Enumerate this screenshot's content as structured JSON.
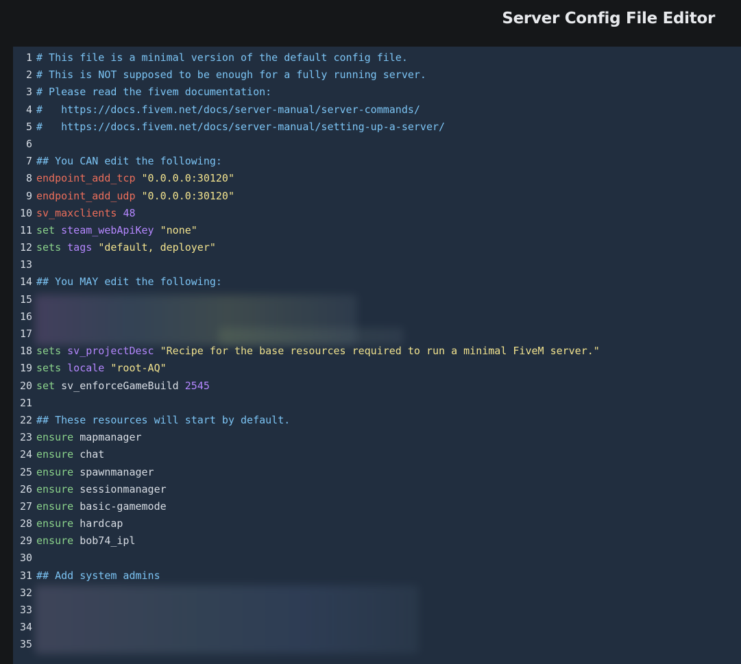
{
  "header": {
    "title": "Server Config File Editor"
  },
  "editor": {
    "lines": [
      {
        "n": "1",
        "segments": [
          {
            "t": "# This file is a minimal version of the default config file.",
            "c": "comment"
          }
        ]
      },
      {
        "n": "2",
        "segments": [
          {
            "t": "# This is NOT supposed to be enough for a fully running server.",
            "c": "comment"
          }
        ]
      },
      {
        "n": "3",
        "segments": [
          {
            "t": "# Please read the fivem documentation:",
            "c": "comment"
          }
        ]
      },
      {
        "n": "4",
        "segments": [
          {
            "t": "#   https://docs.fivem.net/docs/server-manual/server-commands/",
            "c": "comment"
          }
        ]
      },
      {
        "n": "5",
        "segments": [
          {
            "t": "#   https://docs.fivem.net/docs/server-manual/setting-up-a-server/",
            "c": "comment"
          }
        ]
      },
      {
        "n": "6",
        "segments": []
      },
      {
        "n": "7",
        "segments": [
          {
            "t": "## You CAN edit the following:",
            "c": "comment"
          }
        ]
      },
      {
        "n": "8",
        "segments": [
          {
            "t": "endpoint_add_tcp",
            "c": "redkey"
          },
          {
            "t": " ",
            "c": "plain"
          },
          {
            "t": "\"0.0.0.0:30120\"",
            "c": "str"
          }
        ]
      },
      {
        "n": "9",
        "segments": [
          {
            "t": "endpoint_add_udp",
            "c": "redkey"
          },
          {
            "t": " ",
            "c": "plain"
          },
          {
            "t": "\"0.0.0.0:30120\"",
            "c": "str"
          }
        ]
      },
      {
        "n": "10",
        "segments": [
          {
            "t": "sv_maxclients",
            "c": "redkey"
          },
          {
            "t": " ",
            "c": "plain"
          },
          {
            "t": "48",
            "c": "purple"
          }
        ]
      },
      {
        "n": "11",
        "segments": [
          {
            "t": "set",
            "c": "greenkey"
          },
          {
            "t": " ",
            "c": "plain"
          },
          {
            "t": "steam_webApiKey",
            "c": "purple"
          },
          {
            "t": " ",
            "c": "plain"
          },
          {
            "t": "\"none\"",
            "c": "str"
          }
        ]
      },
      {
        "n": "12",
        "segments": [
          {
            "t": "sets",
            "c": "greenkey"
          },
          {
            "t": " ",
            "c": "plain"
          },
          {
            "t": "tags",
            "c": "purple"
          },
          {
            "t": " ",
            "c": "plain"
          },
          {
            "t": "\"default, deployer\"",
            "c": "str"
          }
        ]
      },
      {
        "n": "13",
        "segments": []
      },
      {
        "n": "14",
        "segments": [
          {
            "t": "## You MAY edit the following:",
            "c": "comment"
          }
        ]
      },
      {
        "n": "15",
        "segments": []
      },
      {
        "n": "16",
        "segments": []
      },
      {
        "n": "17",
        "segments": []
      },
      {
        "n": "18",
        "segments": [
          {
            "t": "sets",
            "c": "greenkey"
          },
          {
            "t": " ",
            "c": "plain"
          },
          {
            "t": "sv_projectDesc",
            "c": "purple"
          },
          {
            "t": " ",
            "c": "plain"
          },
          {
            "t": "\"Recipe for the base resources required to run a minimal FiveM server.\"",
            "c": "str"
          }
        ]
      },
      {
        "n": "19",
        "segments": [
          {
            "t": "sets",
            "c": "greenkey"
          },
          {
            "t": " ",
            "c": "plain"
          },
          {
            "t": "locale",
            "c": "purple"
          },
          {
            "t": " ",
            "c": "plain"
          },
          {
            "t": "\"root-AQ\"",
            "c": "str"
          }
        ]
      },
      {
        "n": "20",
        "segments": [
          {
            "t": "set",
            "c": "greenkey"
          },
          {
            "t": " ",
            "c": "plain"
          },
          {
            "t": "sv_enforceGameBuild",
            "c": "plain"
          },
          {
            "t": " ",
            "c": "plain"
          },
          {
            "t": "2545",
            "c": "purple"
          }
        ]
      },
      {
        "n": "21",
        "segments": []
      },
      {
        "n": "22",
        "segments": [
          {
            "t": "## These resources will start by default.",
            "c": "comment"
          }
        ]
      },
      {
        "n": "23",
        "segments": [
          {
            "t": "ensure",
            "c": "greenkey"
          },
          {
            "t": " mapmanager",
            "c": "plain"
          }
        ]
      },
      {
        "n": "24",
        "segments": [
          {
            "t": "ensure",
            "c": "greenkey"
          },
          {
            "t": " chat",
            "c": "plain"
          }
        ]
      },
      {
        "n": "25",
        "segments": [
          {
            "t": "ensure",
            "c": "greenkey"
          },
          {
            "t": " spawnmanager",
            "c": "plain"
          }
        ]
      },
      {
        "n": "26",
        "segments": [
          {
            "t": "ensure",
            "c": "greenkey"
          },
          {
            "t": " sessionmanager",
            "c": "plain"
          }
        ]
      },
      {
        "n": "27",
        "segments": [
          {
            "t": "ensure",
            "c": "greenkey"
          },
          {
            "t": " basic-gamemode",
            "c": "plain"
          }
        ]
      },
      {
        "n": "28",
        "segments": [
          {
            "t": "ensure",
            "c": "greenkey"
          },
          {
            "t": " hardcap",
            "c": "plain"
          }
        ]
      },
      {
        "n": "29",
        "segments": [
          {
            "t": "ensure",
            "c": "greenkey"
          },
          {
            "t": " bob74_ipl",
            "c": "plain"
          }
        ]
      },
      {
        "n": "30",
        "segments": []
      },
      {
        "n": "31",
        "segments": [
          {
            "t": "## Add system admins",
            "c": "comment"
          }
        ]
      },
      {
        "n": "32",
        "segments": []
      },
      {
        "n": "33",
        "segments": []
      },
      {
        "n": "34",
        "segments": []
      },
      {
        "n": "35",
        "segments": []
      }
    ]
  },
  "colors": {
    "background": "#151719",
    "editor_bg": "#212e3f",
    "comment": "#7cc4f4",
    "keyword_red": "#ee6f5b",
    "keyword_green": "#8bd38b",
    "identifier_purple": "#b587ff",
    "string": "#f2e38e"
  }
}
